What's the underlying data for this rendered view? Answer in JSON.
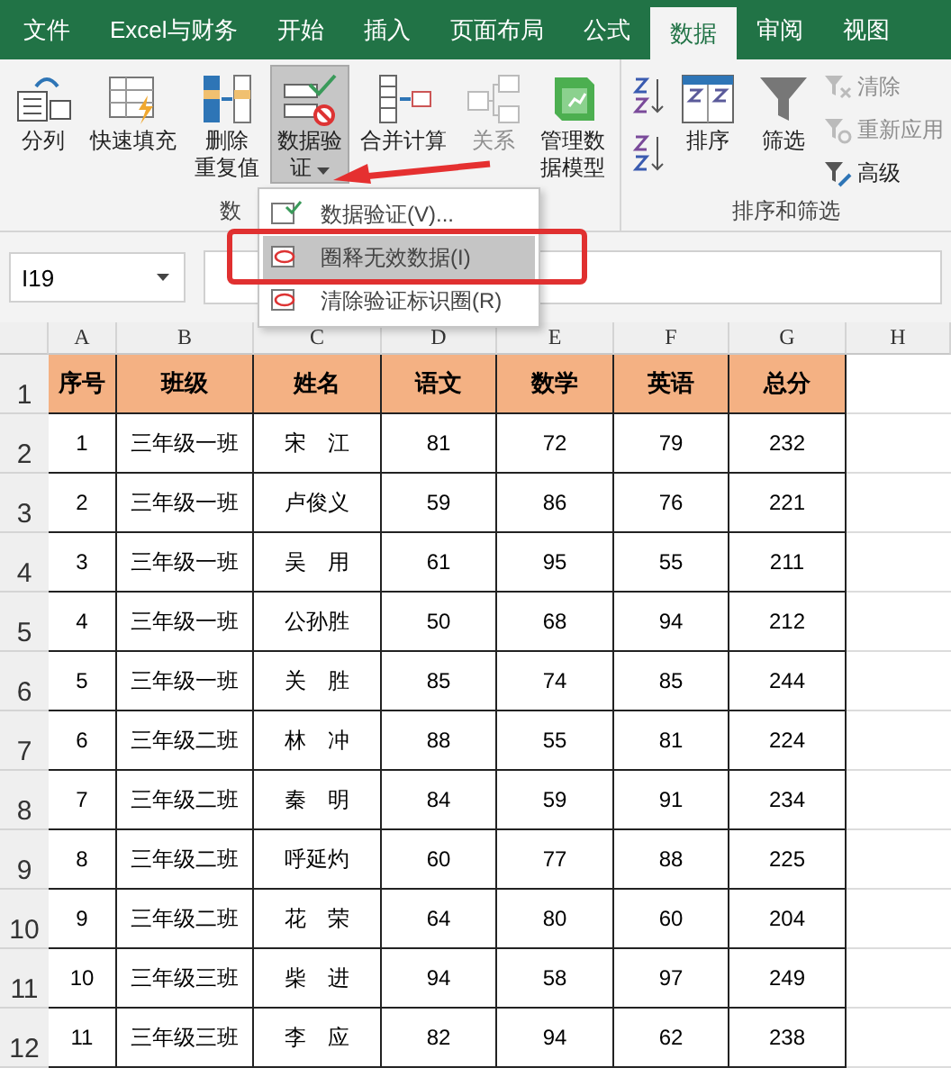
{
  "tabs": [
    {
      "label": "文件",
      "selected": false
    },
    {
      "label": "Excel与财务",
      "selected": false
    },
    {
      "label": "开始",
      "selected": false
    },
    {
      "label": "插入",
      "selected": false
    },
    {
      "label": "页面布局",
      "selected": false
    },
    {
      "label": "公式",
      "selected": false
    },
    {
      "label": "数据",
      "selected": true
    },
    {
      "label": "审阅",
      "selected": false
    },
    {
      "label": "视图",
      "selected": false
    }
  ],
  "ribbon": {
    "groups": [
      {
        "label": "数",
        "buttons": [
          {
            "kind": "large",
            "label": "分列",
            "disabled": false
          },
          {
            "kind": "large",
            "label": "快速填充",
            "disabled": false
          },
          {
            "kind": "large",
            "label_lines": [
              "删除",
              "重复值"
            ],
            "disabled": false
          },
          {
            "kind": "large",
            "label_lines": [
              "数据验",
              "证"
            ],
            "disabled": false,
            "pressed": true,
            "dropdown": true
          },
          {
            "kind": "large",
            "label": "合并计算",
            "disabled": false
          },
          {
            "kind": "large",
            "label": "关系",
            "disabled": true
          },
          {
            "kind": "large",
            "label_lines": [
              "管理数",
              "据模型"
            ],
            "disabled": false
          }
        ]
      },
      {
        "label": "排序和筛选",
        "buttons": [
          {
            "kind": "sortpair"
          },
          {
            "kind": "large",
            "label": "排序",
            "disabled": false
          },
          {
            "kind": "large",
            "label": "筛选",
            "disabled": false
          },
          {
            "kind": "small",
            "label": "清除",
            "disabled": true
          },
          {
            "kind": "small",
            "label": "重新应用",
            "disabled": true
          },
          {
            "kind": "small",
            "label": "高级",
            "disabled": false
          }
        ]
      }
    ]
  },
  "menu": {
    "items": [
      {
        "label": "数据验证(V)...",
        "selected": false
      },
      {
        "label": "圈释无效数据(I)",
        "selected": true
      },
      {
        "label": "清除验证标识圈(R)",
        "selected": false
      }
    ]
  },
  "name_box": {
    "value": "I19"
  },
  "sheet": {
    "columns": [
      "A",
      "B",
      "C",
      "D",
      "E",
      "F",
      "G",
      "H"
    ],
    "header": {
      "row": "1",
      "cells": [
        "序号",
        "班级",
        "姓名",
        "语文",
        "数学",
        "英语",
        "总分"
      ]
    },
    "rows": [
      {
        "row": "2",
        "cells": [
          "1",
          "三年级一班",
          "宋　江",
          "81",
          "72",
          "79",
          "232"
        ]
      },
      {
        "row": "3",
        "cells": [
          "2",
          "三年级一班",
          "卢俊义",
          "59",
          "86",
          "76",
          "221"
        ]
      },
      {
        "row": "4",
        "cells": [
          "3",
          "三年级一班",
          "吴　用",
          "61",
          "95",
          "55",
          "211"
        ]
      },
      {
        "row": "5",
        "cells": [
          "4",
          "三年级一班",
          "公孙胜",
          "50",
          "68",
          "94",
          "212"
        ]
      },
      {
        "row": "6",
        "cells": [
          "5",
          "三年级一班",
          "关　胜",
          "85",
          "74",
          "85",
          "244"
        ]
      },
      {
        "row": "7",
        "cells": [
          "6",
          "三年级二班",
          "林　冲",
          "88",
          "55",
          "81",
          "224"
        ]
      },
      {
        "row": "8",
        "cells": [
          "7",
          "三年级二班",
          "秦　明",
          "84",
          "59",
          "91",
          "234"
        ]
      },
      {
        "row": "9",
        "cells": [
          "8",
          "三年级二班",
          "呼延灼",
          "60",
          "77",
          "88",
          "225"
        ]
      },
      {
        "row": "10",
        "cells": [
          "9",
          "三年级二班",
          "花　荣",
          "64",
          "80",
          "60",
          "204"
        ]
      },
      {
        "row": "11",
        "cells": [
          "10",
          "三年级三班",
          "柴　进",
          "94",
          "58",
          "97",
          "249"
        ]
      },
      {
        "row": "12",
        "cells": [
          "11",
          "三年级三班",
          "李　应",
          "82",
          "94",
          "62",
          "238"
        ]
      }
    ]
  }
}
